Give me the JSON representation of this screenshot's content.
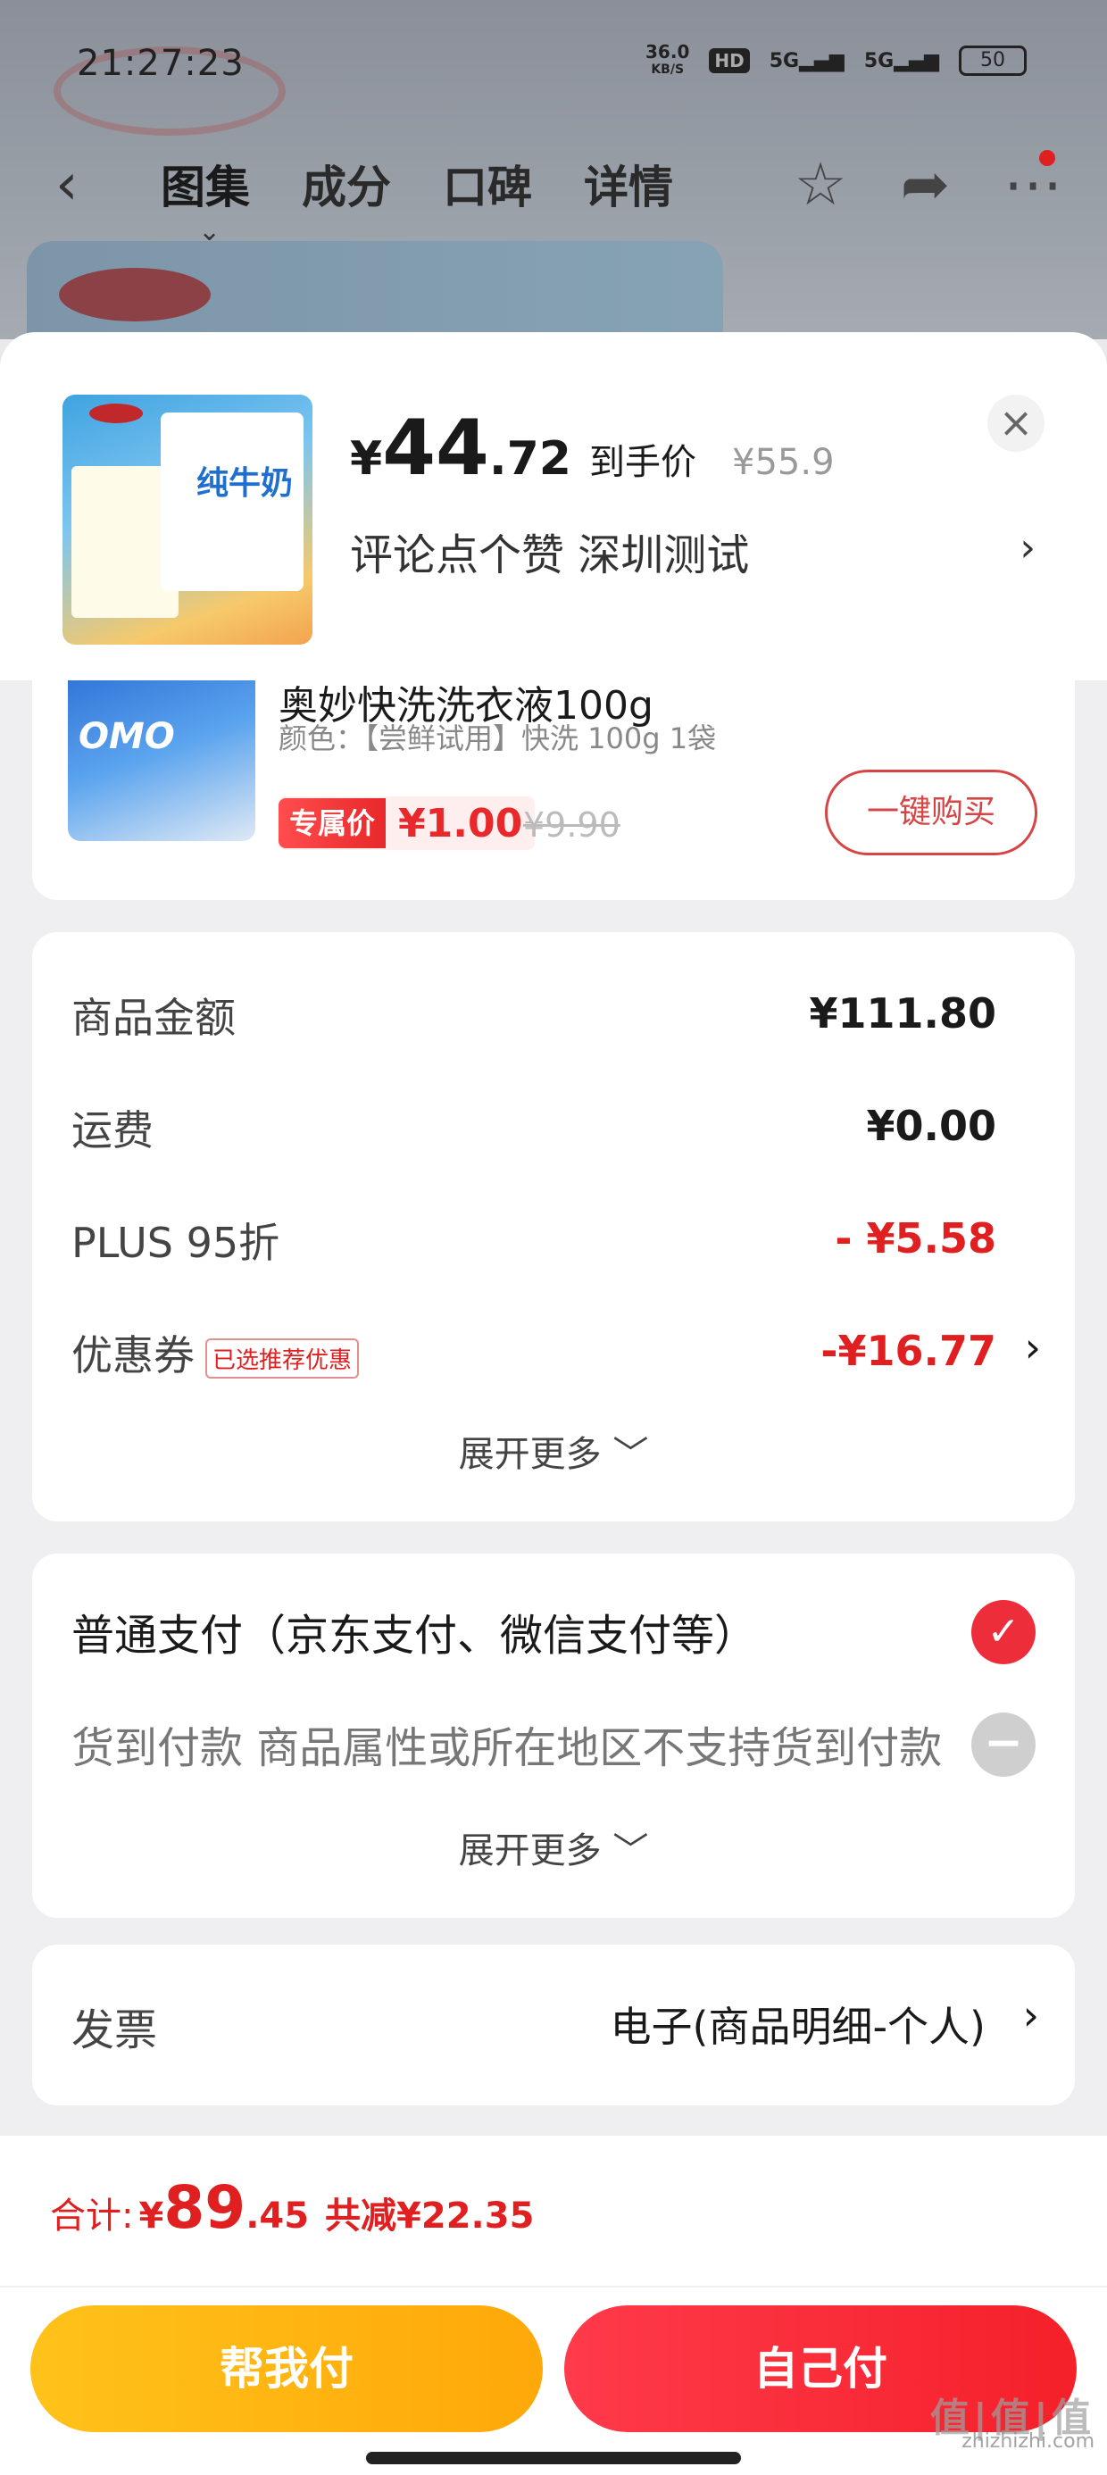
{
  "status_bar": {
    "time": "21:27:23",
    "net_speed": "36.0",
    "net_unit": "KB/S",
    "hd": "HD",
    "signal1": "5G",
    "signal2": "5G",
    "battery": "50"
  },
  "nav": {
    "tabs": [
      "图集",
      "成分",
      "口碑",
      "详情"
    ]
  },
  "product": {
    "price_symbol": "¥",
    "price_int": "44",
    "price_dec": ".72",
    "price_tag": "到手价",
    "price_original": "¥55.9",
    "address": "评论点个赞  深圳测试",
    "thumb_text": "纯牛奶"
  },
  "gift": {
    "title": "奥妙快洗洗衣液100g",
    "spec": "颜色：【尝鲜试用】快洗 100g 1袋",
    "price_tag": "专属价",
    "price": "¥1.00",
    "price_original": "¥9.90",
    "buy_label": "一键购买",
    "thumb_brand": "OMO"
  },
  "amounts": {
    "rows": [
      {
        "label": "商品金额",
        "value": "¥111.80"
      },
      {
        "label": "运费",
        "value": "¥0.00"
      },
      {
        "label": "PLUS 95折",
        "value": "- ¥5.58"
      },
      {
        "label": "优惠券",
        "badge": "已选推荐优惠",
        "value": "-¥16.77"
      }
    ],
    "expand": "展开更多 ﹀"
  },
  "payment": {
    "normal": "普通支付（京东支付、微信支付等）",
    "cod": "货到付款 商品属性或所在地区不支持货到付款",
    "expand": "展开更多 ﹀"
  },
  "invoice": {
    "label": "发票",
    "value": "电子(商品明细-个人)"
  },
  "bottom": {
    "total_label": "合计:",
    "total_symbol": "¥",
    "total_int": "89",
    "total_dec": ".45",
    "total_save": "共减¥22.35",
    "help_pay": "帮我付",
    "self_pay": "自己付"
  },
  "watermark": {
    "logo": "值|值|值",
    "url": "zhizhizhi.com"
  },
  "colors": {
    "accent_red": "#e02020",
    "pay_red": "#f4202a",
    "help_yellow": "#ffb012"
  }
}
